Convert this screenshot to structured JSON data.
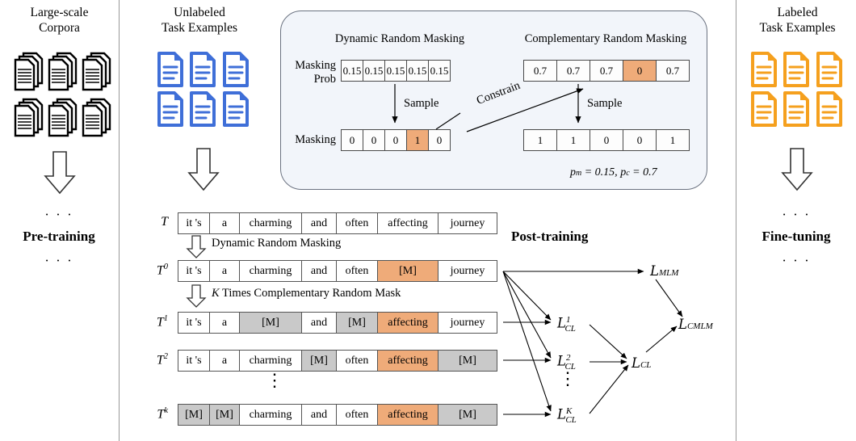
{
  "columns": {
    "left": {
      "title_line1": "Large-scale",
      "title_line2": "Corpora",
      "icon": "stacked-documents-icon",
      "dots_top": "· · ·",
      "stage": "Pre-training",
      "dots_bottom": "· · ·"
    },
    "middle": {
      "title_line1": "Unlabeled",
      "title_line2": "Task Examples",
      "icon": "blue-documents-icon",
      "stage": "Post-training"
    },
    "right": {
      "title_line1": "Labeled",
      "title_line2": "Task Examples",
      "icon": "orange-documents-icon",
      "dots_top": "· · ·",
      "stage": "Fine-tuning",
      "dots_bottom": "· · ·"
    }
  },
  "panel": {
    "left_title": "Dynamic Random Masking",
    "right_title": "Complementary Random Masking",
    "masking_prob_label_line1": "Masking",
    "masking_prob_label_line2": "Prob",
    "masking_label": "Masking",
    "sample_label_left": "Sample",
    "sample_label_right": "Sample",
    "constrain_label": "Constrain",
    "left_prob_values": [
      "0.15",
      "0.15",
      "0.15",
      "0.15",
      "0.15"
    ],
    "left_prob_highlight": [
      false,
      false,
      false,
      false,
      false
    ],
    "left_mask_values": [
      "0",
      "0",
      "0",
      "1",
      "0"
    ],
    "left_mask_highlight": [
      false,
      false,
      false,
      true,
      false
    ],
    "right_prob_values": [
      "0.7",
      "0.7",
      "0.7",
      "0",
      "0.7"
    ],
    "right_prob_highlight": [
      false,
      false,
      false,
      true,
      false
    ],
    "right_mask_values": [
      "1",
      "1",
      "0",
      "0",
      "1"
    ],
    "right_mask_highlight": [
      false,
      false,
      false,
      false,
      false
    ],
    "formula": "p",
    "formula_full": "pm = 0.15, pc = 0.7",
    "formula_parts": {
      "p1": "p",
      "sub1": "m",
      "eq1": " = 0.15, ",
      "p2": "p",
      "sub2": "c",
      "eq2": " = 0.7"
    }
  },
  "sequence": {
    "arrow_label_1": "Dynamic Random Masking",
    "arrow_label_2_k": "K",
    "arrow_label_2_rest": " Times Complementary Random Mask",
    "vertical_dots": "⋮",
    "rows": [
      {
        "name": "T",
        "sup": "",
        "tokens": [
          {
            "text": "it 's",
            "style": "plain"
          },
          {
            "text": "a",
            "style": "plain"
          },
          {
            "text": "charming",
            "style": "plain"
          },
          {
            "text": "and",
            "style": "plain"
          },
          {
            "text": "often",
            "style": "plain"
          },
          {
            "text": "affecting",
            "style": "plain"
          },
          {
            "text": "journey",
            "style": "plain"
          }
        ]
      },
      {
        "name": "T",
        "sup": "0",
        "tokens": [
          {
            "text": "it 's",
            "style": "plain"
          },
          {
            "text": "a",
            "style": "plain"
          },
          {
            "text": "charming",
            "style": "plain"
          },
          {
            "text": "and",
            "style": "plain"
          },
          {
            "text": "often",
            "style": "plain"
          },
          {
            "text": "[M]",
            "style": "orange"
          },
          {
            "text": "journey",
            "style": "plain"
          }
        ]
      },
      {
        "name": "T",
        "sup": "1",
        "tokens": [
          {
            "text": "it 's",
            "style": "plain"
          },
          {
            "text": "a",
            "style": "plain"
          },
          {
            "text": "[M]",
            "style": "gray"
          },
          {
            "text": "and",
            "style": "plain"
          },
          {
            "text": "[M]",
            "style": "gray"
          },
          {
            "text": "affecting",
            "style": "orange"
          },
          {
            "text": "journey",
            "style": "plain"
          }
        ]
      },
      {
        "name": "T",
        "sup": "2",
        "tokens": [
          {
            "text": "it 's",
            "style": "plain"
          },
          {
            "text": "a",
            "style": "plain"
          },
          {
            "text": "charming",
            "style": "plain"
          },
          {
            "text": "[M]",
            "style": "gray"
          },
          {
            "text": "often",
            "style": "plain"
          },
          {
            "text": "affecting",
            "style": "orange"
          },
          {
            "text": "[M]",
            "style": "gray"
          }
        ]
      },
      {
        "name": "T",
        "sup": "k",
        "tokens": [
          {
            "text": "[M]",
            "style": "gray"
          },
          {
            "text": "[M]",
            "style": "gray"
          },
          {
            "text": "charming",
            "style": "plain"
          },
          {
            "text": "and",
            "style": "plain"
          },
          {
            "text": "often",
            "style": "plain"
          },
          {
            "text": "affecting",
            "style": "orange"
          },
          {
            "text": "[M]",
            "style": "gray"
          }
        ]
      }
    ]
  },
  "losses": {
    "mlm": {
      "base": "L",
      "sub": "MLM",
      "sup": ""
    },
    "cl1": {
      "base": "L",
      "sub": "CL",
      "sup": "1"
    },
    "cl2": {
      "base": "L",
      "sub": "CL",
      "sup": "2"
    },
    "clk": {
      "base": "L",
      "sub": "CL",
      "sup": "K"
    },
    "cl": {
      "base": "L",
      "sub": "CL",
      "sup": ""
    },
    "cmlm": {
      "base": "L",
      "sub": "CMLM",
      "sup": ""
    },
    "vertical_dots": "⋮"
  },
  "colors": {
    "highlight_orange": "#efab79",
    "mask_gray": "#c9c9c9",
    "panel_bg": "#f2f5fa",
    "panel_border": "#6b7280",
    "blue_doc": "#3f6fd8",
    "orange_doc": "#f5a01e",
    "divider": "#9a9a9a"
  }
}
